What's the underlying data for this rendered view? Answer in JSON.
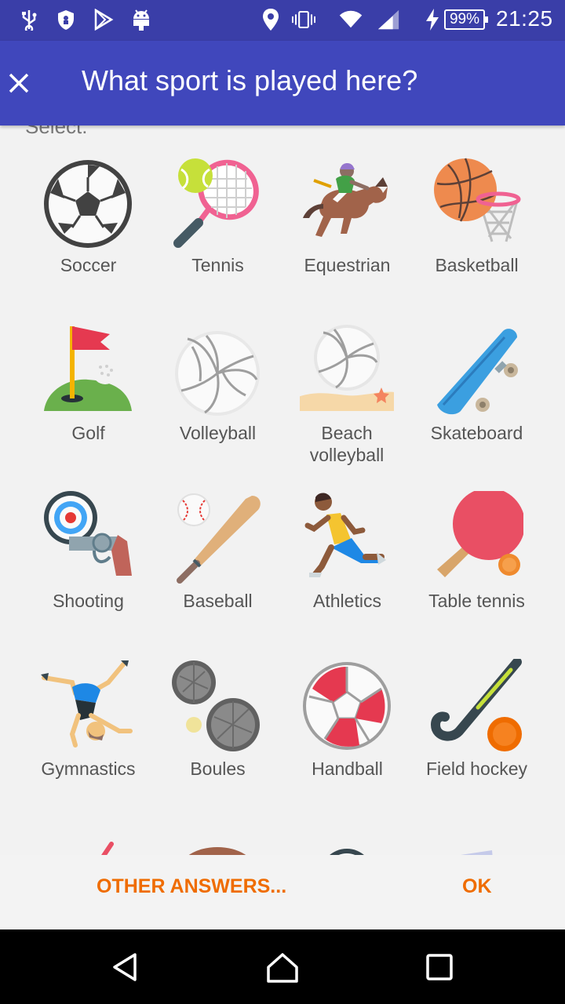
{
  "status_bar": {
    "icons": [
      "usb-icon",
      "shield-icon",
      "play-store-icon",
      "android-icon",
      "location-icon",
      "vibrate-icon",
      "wifi-icon",
      "signal-icon",
      "charging-icon"
    ],
    "battery": "99%",
    "time": "21:25"
  },
  "app_bar": {
    "close_icon": "close-icon",
    "title": "What sport is played here?"
  },
  "content": {
    "select_label": "Select:",
    "sports": [
      {
        "label": "Soccer",
        "icon": "soccer-ball-icon"
      },
      {
        "label": "Tennis",
        "icon": "tennis-racket-icon"
      },
      {
        "label": "Equestrian",
        "icon": "horse-racing-icon"
      },
      {
        "label": "Basketball",
        "icon": "basketball-icon"
      },
      {
        "label": "Golf",
        "icon": "golf-flag-icon"
      },
      {
        "label": "Volleyball",
        "icon": "volleyball-icon"
      },
      {
        "label": "Beach volleyball",
        "icon": "beach-volleyball-icon"
      },
      {
        "label": "Skateboard",
        "icon": "skateboard-icon"
      },
      {
        "label": "Shooting",
        "icon": "target-pistol-icon"
      },
      {
        "label": "Baseball",
        "icon": "baseball-bat-icon"
      },
      {
        "label": "Athletics",
        "icon": "runner-icon"
      },
      {
        "label": "Table tennis",
        "icon": "ping-pong-icon"
      },
      {
        "label": "Gymnastics",
        "icon": "cartwheel-icon"
      },
      {
        "label": "Boules",
        "icon": "boules-icon"
      },
      {
        "label": "Handball",
        "icon": "handball-icon"
      },
      {
        "label": "Field hockey",
        "icon": "field-hockey-icon"
      }
    ]
  },
  "buttons": {
    "other_answers": "OTHER ANSWERS...",
    "ok": "OK"
  },
  "nav_bar": {
    "back_icon": "back-icon",
    "home_icon": "home-icon",
    "recents_icon": "recents-icon"
  },
  "colors": {
    "status_bar": "#3a3ea8",
    "app_bar": "#4047bc",
    "accent": "#ef6c00"
  }
}
